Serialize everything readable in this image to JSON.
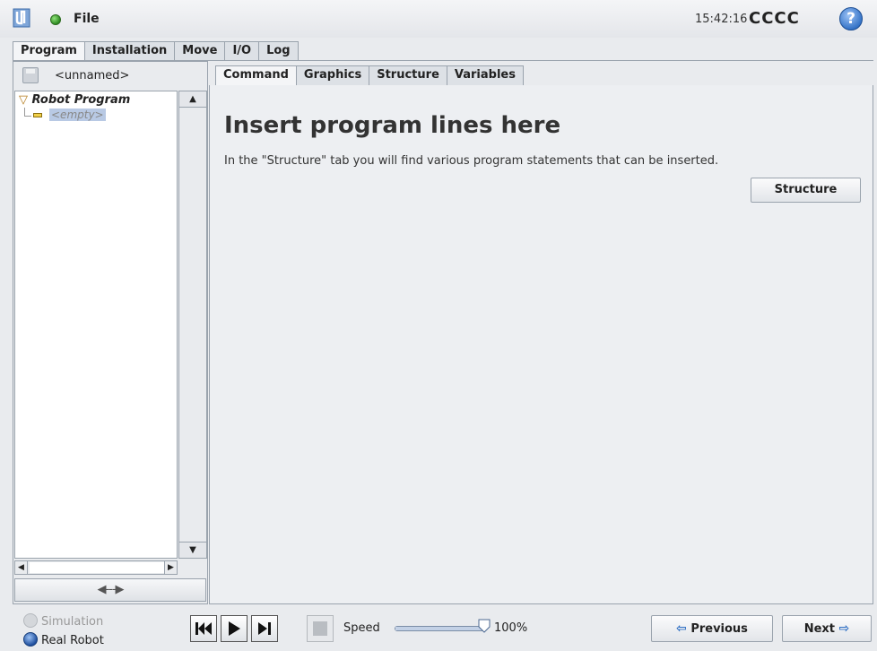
{
  "header": {
    "file_label": "File",
    "clock": "15:42:16",
    "robot_name": "CCCC",
    "help_label": "?"
  },
  "main_tabs": [
    {
      "label": "Program",
      "active": true
    },
    {
      "label": "Installation",
      "active": false
    },
    {
      "label": "Move",
      "active": false
    },
    {
      "label": "I/O",
      "active": false
    },
    {
      "label": "Log",
      "active": false
    }
  ],
  "program": {
    "name": "<unnamed>",
    "tree_root": "Robot Program",
    "tree_child": "<empty>",
    "expand_label": "◀---▶"
  },
  "sub_tabs": [
    {
      "label": "Command",
      "active": true
    },
    {
      "label": "Graphics",
      "active": false
    },
    {
      "label": "Structure",
      "active": false
    },
    {
      "label": "Variables",
      "active": false
    }
  ],
  "content": {
    "title": "Insert program lines here",
    "description": "In the \"Structure\" tab you will find various program statements that can be inserted.",
    "structure_button": "Structure"
  },
  "footer": {
    "simulation_label": "Simulation",
    "real_robot_label": "Real Robot",
    "speed_label": "Speed",
    "speed_value": "100%",
    "speed_fraction": 1.0,
    "previous_label": "Previous",
    "next_label": "Next"
  },
  "colors": {
    "accent": "#2f6fc4",
    "status_ok": "#2e8b22",
    "tree_highlight": "#b8c9e4"
  }
}
